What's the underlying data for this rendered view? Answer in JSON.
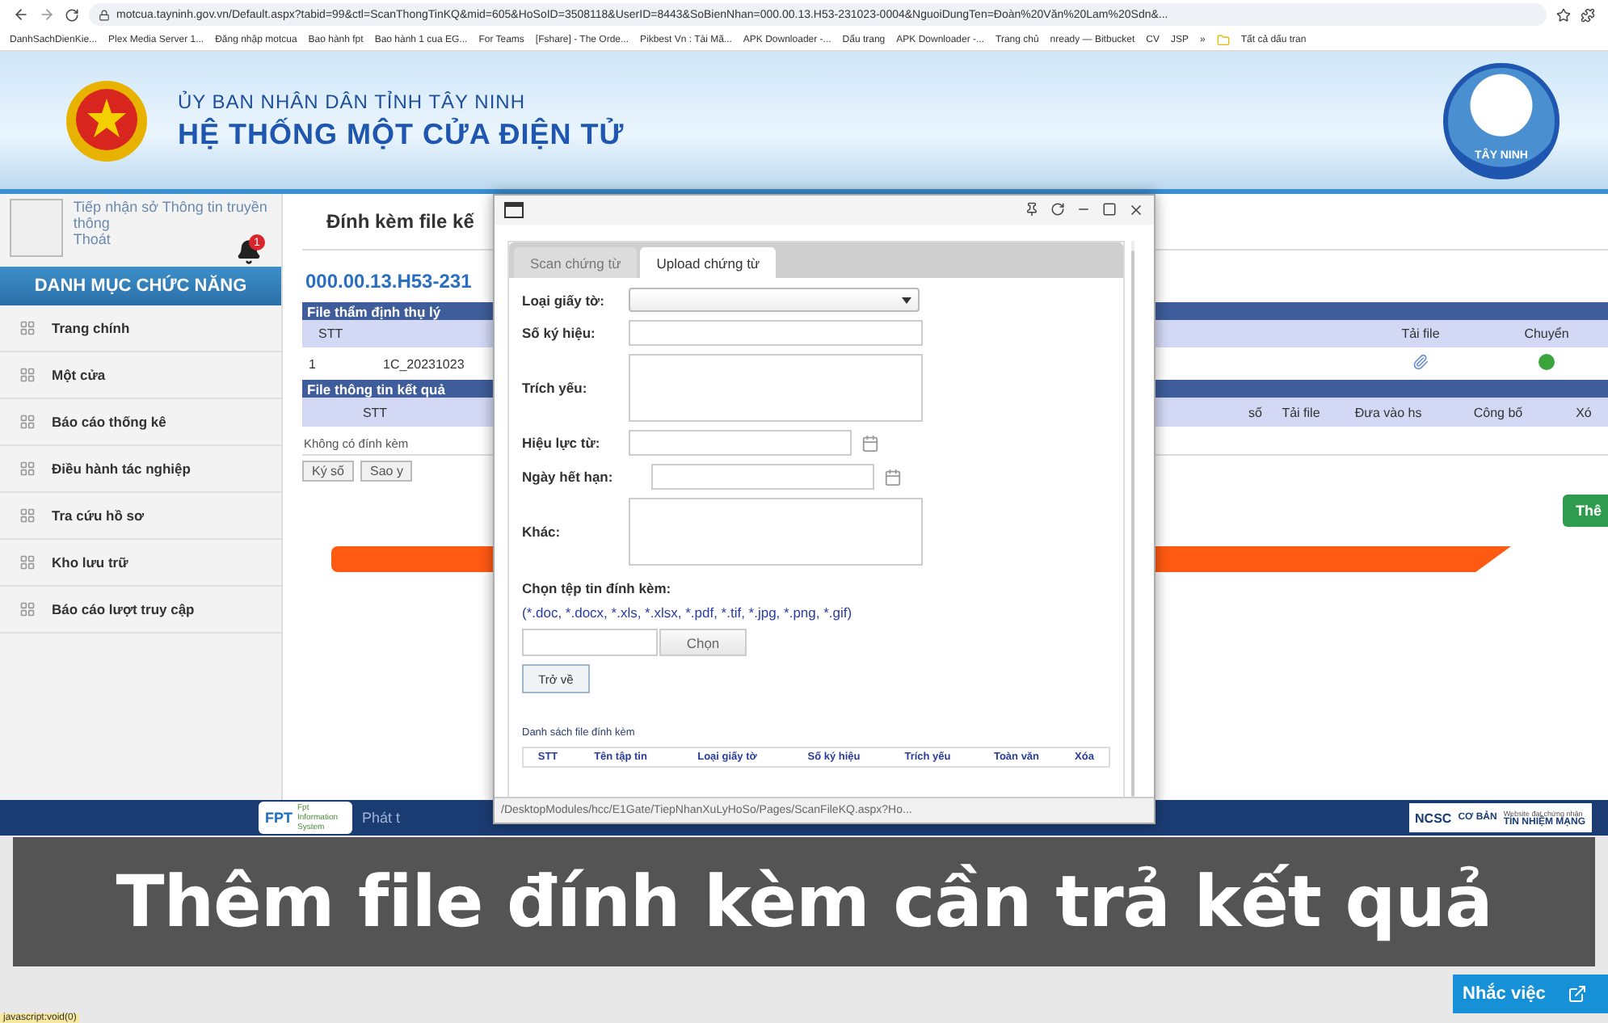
{
  "browser": {
    "url": "motcua.tayninh.gov.vn/Default.aspx?tabid=99&ctl=ScanThongTinKQ&mid=605&HoSoID=3508118&UserID=8443&SoBienNhan=000.00.13.H53-231023-0004&NguoiDungTen=Đoàn%20Văn%20Lam%20Sdn&...",
    "bookmarks": [
      "DanhSachDienKie...",
      "Plex Media Server 1...",
      "Đăng nhập motcua",
      "Bao hành fpt",
      "Bao hành 1 cua EG...",
      "For Teams",
      "[Fshare] - The Orde...",
      "Pikbest Vn : Tài Mã...",
      "APK Downloader -...",
      "Dấu trang",
      "APK Downloader -...",
      "Trang chủ",
      "nready — Bitbucket",
      "CV",
      "JSP"
    ],
    "more": "»",
    "all_bookmarks": "Tất cả dấu tran"
  },
  "header": {
    "line1": "ỦY BAN NHÂN DÂN TỈNH TÂY NINH",
    "line2": "HỆ THỐNG MỘT CỬA ĐIỆN TỬ",
    "logo_text": "TÂY NINH"
  },
  "user": {
    "name": "Tiếp nhận sở Thông tin truyền thông",
    "logout": "Thoát",
    "notifications": "1"
  },
  "sidebar": {
    "title": "DANH MỤC CHỨC NĂNG",
    "items": [
      "Trang chính",
      "Một cửa",
      "Báo cáo thống kê",
      "Điều hành tác nghiệp",
      "Tra cứu hồ sơ",
      "Kho lưu trữ",
      "Báo cáo lượt truy cập"
    ]
  },
  "content": {
    "title": "Đính kèm file kế",
    "code": "000.00.13.H53-231",
    "table1": {
      "title": "File thẩm định thụ lý",
      "columns": [
        "STT",
        "Tải file",
        "Chuyển"
      ],
      "rows": [
        {
          "cells": [
            "1",
            "1C_20231023"
          ]
        }
      ]
    },
    "table2": {
      "title": "File thông tin kết quả",
      "columns": [
        "STT",
        "số",
        "Tải file",
        "Đưa vào hs",
        "Công bố",
        "Xó"
      ],
      "empty_text": "Không có đính kèm"
    },
    "buttons": [
      "Ký số",
      "Sao y"
    ],
    "add_button": "Thê"
  },
  "dialog": {
    "tabs": [
      {
        "label": "Scan chứng từ",
        "selected": false
      },
      {
        "label": "Upload chứng từ",
        "selected": true
      }
    ],
    "fields": [
      {
        "label": "Loại giấy tờ:",
        "kind": "select"
      },
      {
        "label": "Số ký hiệu:",
        "kind": "input"
      },
      {
        "label": "Trích yếu:",
        "kind": "textarea"
      },
      {
        "label": "Hiệu lực từ:",
        "kind": "date"
      },
      {
        "label": "Ngày hết hạn:",
        "kind": "date"
      },
      {
        "label": "Khác:",
        "kind": "textarea"
      }
    ],
    "attach_label": "Chọn tệp tin đính kèm:",
    "extensions": "(*.doc, *.docx, *.xls, *.xlsx, *.pdf, *.tif, *.jpg, *.png, *.gif)",
    "choose_button": "Chọn",
    "back_button": "Trở về",
    "list_title": "Danh sách file đính kèm",
    "list_columns": [
      "STT",
      "Tên tập tin",
      "Loại giấy tờ",
      "Số ký hiệu",
      "Trích yếu",
      "Toàn văn",
      "Xóa"
    ],
    "status_url": "/DesktopModules/hcc/E1Gate/TiepNhanXuLyHoSo/Pages/ScanFileKQ.aspx?Ho..."
  },
  "footer": {
    "logo": "FPT",
    "logo_sub": "Fpt Information System",
    "text": "Phát t",
    "badge": "NCSC",
    "badge_level": "CƠ BẢN",
    "cert_note": "Website đạt chứng nhận",
    "cert_title": "TÍN NHIỆM MẠNG"
  },
  "caption": "Thêm file đính kèm cần trả kết quả",
  "reminder": "Nhắc việc",
  "status": "javascript:void(0)"
}
